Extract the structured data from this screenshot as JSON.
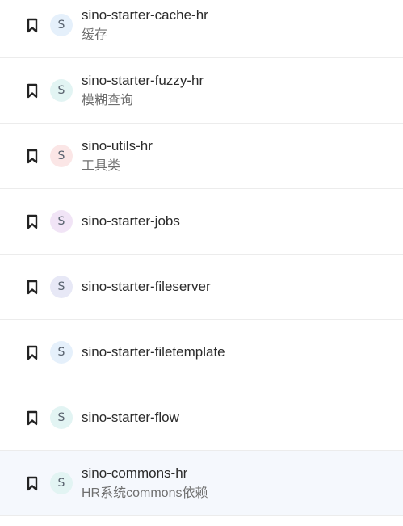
{
  "repositories": [
    {
      "name": "sino-starter-cache-hr",
      "description": "缓存",
      "avatar_letter": "S",
      "avatar_color": "#e5f0fb"
    },
    {
      "name": "sino-starter-fuzzy-hr",
      "description": "模糊查询",
      "avatar_letter": "S",
      "avatar_color": "#e2f4f3"
    },
    {
      "name": "sino-utils-hr",
      "description": "工具类",
      "avatar_letter": "S",
      "avatar_color": "#fbe6e6"
    },
    {
      "name": "sino-starter-jobs",
      "description": "",
      "avatar_letter": "S",
      "avatar_color": "#f1e4f6"
    },
    {
      "name": "sino-starter-fileserver",
      "description": "",
      "avatar_letter": "S",
      "avatar_color": "#e7e8f6"
    },
    {
      "name": "sino-starter-filetemplate",
      "description": "",
      "avatar_letter": "S",
      "avatar_color": "#e5f0fb"
    },
    {
      "name": "sino-starter-flow",
      "description": "",
      "avatar_letter": "S",
      "avatar_color": "#e2f4f3"
    },
    {
      "name": "sino-commons-hr",
      "description": "HR系统commons依赖",
      "avatar_letter": "S",
      "avatar_color": "#e2f4f3"
    }
  ],
  "highlight_color": "#f5f8fd",
  "bookmark_icon": "bookmark-icon"
}
